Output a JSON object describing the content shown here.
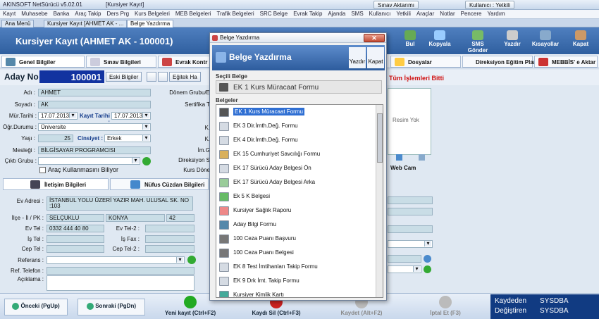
{
  "titlebar": {
    "app": "AKINSOFT NetSürücü v5.02.01",
    "window": "[Kursiyer Kayıt]",
    "alert": "Sınav Aktarımı",
    "user": "Kullanıcı : Yetkili"
  },
  "menu": [
    "Kayıt",
    "Muhasebe",
    "Banka",
    "Araç Takip",
    "Ders Prg",
    "Kurs Belgeleri",
    "MEB Belgeleri",
    "Trafik Belgeleri",
    "SRC Belge",
    "Evrak Takip",
    "Ajanda",
    "SMS",
    "Kullanıcı",
    "Yetkili",
    "Araçlar",
    "Notlar",
    "Pencere",
    "Yardım"
  ],
  "tabs": [
    "Ana Menü",
    "Kursiyer Kayıt [AHMET AK - ...",
    "Belge Yazdırma"
  ],
  "header": {
    "title": "Kursiyer Kayıt (AHMET AK - 100001)",
    "buttons": [
      "Bul",
      "Kopyala",
      "SMS Gönder",
      "Yazdır",
      "Kısayollar",
      "Kapat"
    ]
  },
  "subtabs": [
    "Genel Bilgiler",
    "Sınav Bilgileri",
    "Evrak Kontr",
    "Dosyalar",
    "Direksiyon Eğitim Planı",
    "MEBBİS' e Aktar"
  ],
  "aday": {
    "label": "Aday No :",
    "value": "100001",
    "old_btn": "Eski Bilgiler",
    "edu_btn": "Eğitek Ha",
    "warning": "Tüm İşlemleri Bitti"
  },
  "form": {
    "adi_l": "Adı :",
    "adi": "AHMET",
    "soyadi_l": "Soyadı :",
    "soyadi": "AK",
    "mur_l": "Mür.Tarihi :",
    "mur": "17.07.2013",
    "kayit_l": "Kayıt Tarihi :",
    "kayit": "17.07.2013",
    "ogr_l": "Öğr.Durumu :",
    "ogr": "Üniversite",
    "yas_l": "Yaşı :",
    "yas": "25",
    "cins_l": "Cinsiyet :",
    "cins": "Erkek",
    "meslek_l": "Mesleği :",
    "meslek": "BİLGİSAYAR PROGRAMCISI",
    "cikti_l": "Çıktı Grubu :",
    "cikti": "",
    "arac": "Araç Kullanmasını Biliyor",
    "donem_l": "Dönem Grubu/E",
    "sertifika_l": "Sertifika T",
    "k1": "K.",
    "k2": "K.",
    "im": "İm.G",
    "dir_l": "Direksiyon S",
    "kurs_l": "Kurs Döne"
  },
  "infotabs": [
    "İletişim Bilgileri",
    "Nüfus Cüzdan Bilgileri"
  ],
  "contact": {
    "adres_l": "Ev Adresi :",
    "adres": "İSTANBUL YOLU ÜZERİ YAZIR MAH. ULUSAL SK. NO :103",
    "ilce_l": "İlçe - İl / PK :",
    "ilce": "SELÇUKLU",
    "il": "KONYA",
    "pk": "42",
    "evtel_l": "Ev Tel :",
    "evtel": "0332 444 40 80",
    "evtel2_l": "Ev Tel-2 :",
    "istel_l": "İş Tel :",
    "isfax_l": "İş Fax :",
    "ceptel_l": "Cep Tel :",
    "ceptel2_l": "Cep Tel-2 :",
    "ref_l": "Referans :",
    "reftel_l": "Ref. Telefon :",
    "acik_l": "Açıklama :"
  },
  "photo": {
    "none": "Resim Yok",
    "webcam": "Web Cam"
  },
  "footer": {
    "prev": "Önceki (PgUp)",
    "next": "Sonraki (PgDn)",
    "new": "Yeni kayıt (Ctrl+F2)",
    "del": "Kaydı Sil (Ctrl+F3)",
    "save": "Kaydet (Alt+F2)",
    "cancel": "İptal Et (F3)"
  },
  "status": {
    "k_l": "Kaydeden",
    "k": "SYSDBA",
    "d_l": "Değiştiren",
    "d": "SYSDBA"
  },
  "dialog": {
    "title": "Belge Yazdırma",
    "heading": "Belge Yazdırma",
    "print": "Yazdır",
    "close": "Kapat",
    "selected_label": "Seçili Belge",
    "selected": "EK 1 Kurs Müracaat Formu",
    "list_label": "Belgeler",
    "items": [
      "EK 1 Kurs Müracaat Formu",
      "EK 3 Dir.İmth.Değ. Formu",
      "EK 4 Dir.İmth.Değ. Formu",
      "EK 15 Cumhuriyet Savcılığı Formu",
      "EK 17 Sürücü Aday Belgesi Ön",
      "EK 17 Sürücü Aday Belgesi Arka",
      "Ek 5 K Belgesi",
      "Kursiyer Sağlık Raporu",
      "Aday Bilgi Formu",
      "100 Ceza Puanı Başvuru",
      "100 Ceza Puanı Belgesi",
      "EK 8 Test İmtihanları Takip Formu",
      "EK 9 Drk İmt. Takip Formu",
      "Kursiyer Kimlik Kartı"
    ]
  },
  "colors": {
    "header": "#2f5f9f",
    "status": "#113b82",
    "selection": "#2f6fd3"
  }
}
